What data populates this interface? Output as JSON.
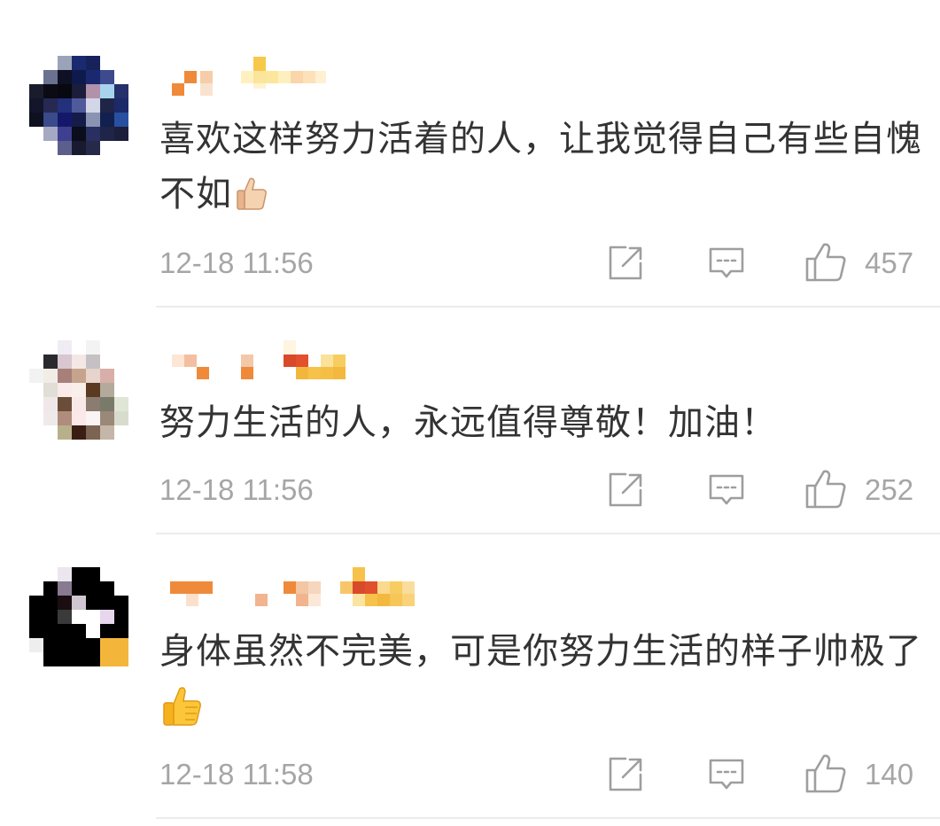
{
  "comments": [
    {
      "text": "喜欢这样努力活着的人，让我觉得自己有些自愧不如",
      "emoji": "thumbs-up-light-icon",
      "time": "12-18 11:56",
      "likes": "457"
    },
    {
      "text": "努力生活的人，永远值得尊敬！加油！",
      "emoji": "",
      "time": "12-18 11:56",
      "likes": "252"
    },
    {
      "text": "身体虽然不完美，可是你努力生活的样子帅极了",
      "emoji": "thumbs-up-yellow-icon",
      "time": "12-18 11:58",
      "likes": "140"
    }
  ],
  "colors": {
    "text": "#333333",
    "meta": "#a6a6a6",
    "icon": "#9e9e9e",
    "divider": "#ececec"
  }
}
